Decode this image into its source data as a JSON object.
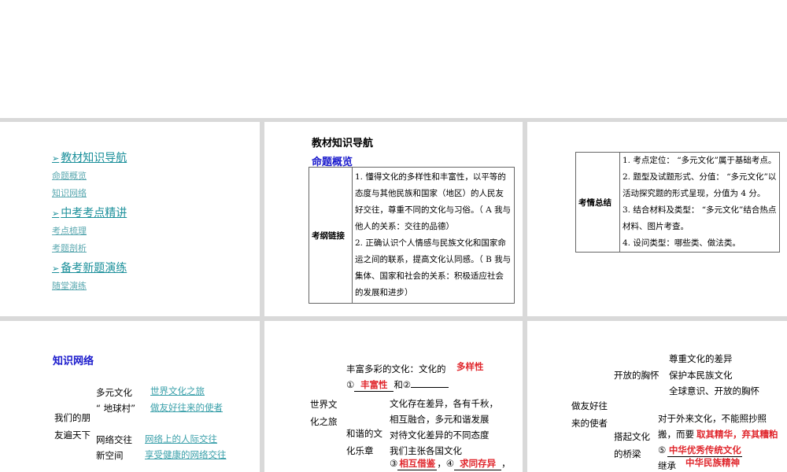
{
  "nav": {
    "sections": [
      {
        "title": "教材知识导航",
        "items": [
          "命题概览",
          "知识网络"
        ]
      },
      {
        "title": "中考考点精讲",
        "items": [
          "考点梳理",
          "考题剖析"
        ]
      },
      {
        "title": "备考新题演练",
        "items": [
          "随堂演练"
        ]
      }
    ]
  },
  "overview": {
    "heading": "教材知识导航",
    "subheading": "命题概览",
    "label": "考纲链接",
    "p1": "1. 懂得文化的多样性和丰富性，以平等的态度与其他民族和国家（地区）的人民友好交往，尊重不同的文化与习俗。（ A  我与他人的关系：交往的品德）",
    "p2": "2. 正确认识个人情感与民族文化和国家命运之间的联系，提高文化认同感。（ B  我与集体、国家和社会的关系：积极适应社会的发展和进步）"
  },
  "summary": {
    "label": "考情总结",
    "items": [
      "1. 考点定位：  “多元文化”属于基础考点。",
      "2. 题型及试题形式、分值：  “多元文化”以活动探究题的形式呈现，分值为 4 分。",
      "3. 结合材料及类型：  “多元文化”结合热点材料、图片考查。",
      "4. 设问类型：哪些类、做法类。"
    ]
  },
  "network": {
    "heading": "知识网络",
    "root": "我们的朋友遍天下",
    "b1": "多元文化",
    "b1b": "“ 地球村”",
    "l1": "世界文化之旅",
    "l2": "做友好往来的使者",
    "b2": "网络交往",
    "b2b": "新空间",
    "l3": "网络上的人际交往",
    "l4": "享受健康的网络交往"
  },
  "world": {
    "root": "世界文化之旅",
    "rich": "丰富多彩的文化：文化的",
    "c1": "①",
    "a1": "丰富性",
    "and": "和②",
    "a2": "多样性",
    "harm": "和谐的文化乐章",
    "lines": [
      "文化存在差异，各有千秋，",
      "相互融合，多元和谐发展",
      "对待文化差异的不同态度",
      "我们主张各国文化"
    ],
    "c3": "③",
    "a3": "相互借鉴",
    "c4": "，④",
    "a4": "求同存异",
    "end": "，"
  },
  "envoy": {
    "root": "做友好往来的使者",
    "open": "开放的胸怀",
    "open_items": [
      "尊重文化的差异",
      "保护本民族文化",
      "全球意识、开放的胸怀"
    ],
    "bridge": "搭起文化的桥梁",
    "l1": "对于外来文化，不能照抄照",
    "l2": "搬，而要",
    "a1": "取其精华，弃其糟粕",
    "c5": "⑤",
    "a5": "中华优秀传统文化",
    "inherit": "继承",
    "a6": "中华民族精神"
  }
}
